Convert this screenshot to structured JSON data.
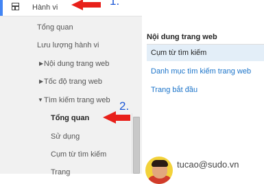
{
  "nav": {
    "section_title": "Hành vi",
    "items": [
      {
        "label": "Tổng quan"
      },
      {
        "label": "Lưu lượng hành vi"
      },
      {
        "label": "Nội dung trang web"
      },
      {
        "label": "Tốc độ trang web"
      },
      {
        "label": "Tìm kiếm trang web"
      },
      {
        "label": "Tổng quan"
      },
      {
        "label": "Sử dụng"
      },
      {
        "label": "Cụm từ tìm kiếm"
      },
      {
        "label": "Trang"
      }
    ]
  },
  "annotations": {
    "step1": "1.",
    "step2": "2.",
    "arrow_color": "#e8201a",
    "number_color": "#1a56d6"
  },
  "right_pane": {
    "title": "Nội dung trang web",
    "items": [
      {
        "label": "Cụm từ tìm kiếm"
      },
      {
        "label": "Danh mục tìm kiếm trang web"
      },
      {
        "label": "Trang bắt đầu"
      }
    ]
  },
  "user": {
    "email": "tucao@sudo.vn"
  },
  "colors": {
    "accent": "#4285f4",
    "link": "#1a73c9",
    "active_bg": "#e3eef8"
  }
}
